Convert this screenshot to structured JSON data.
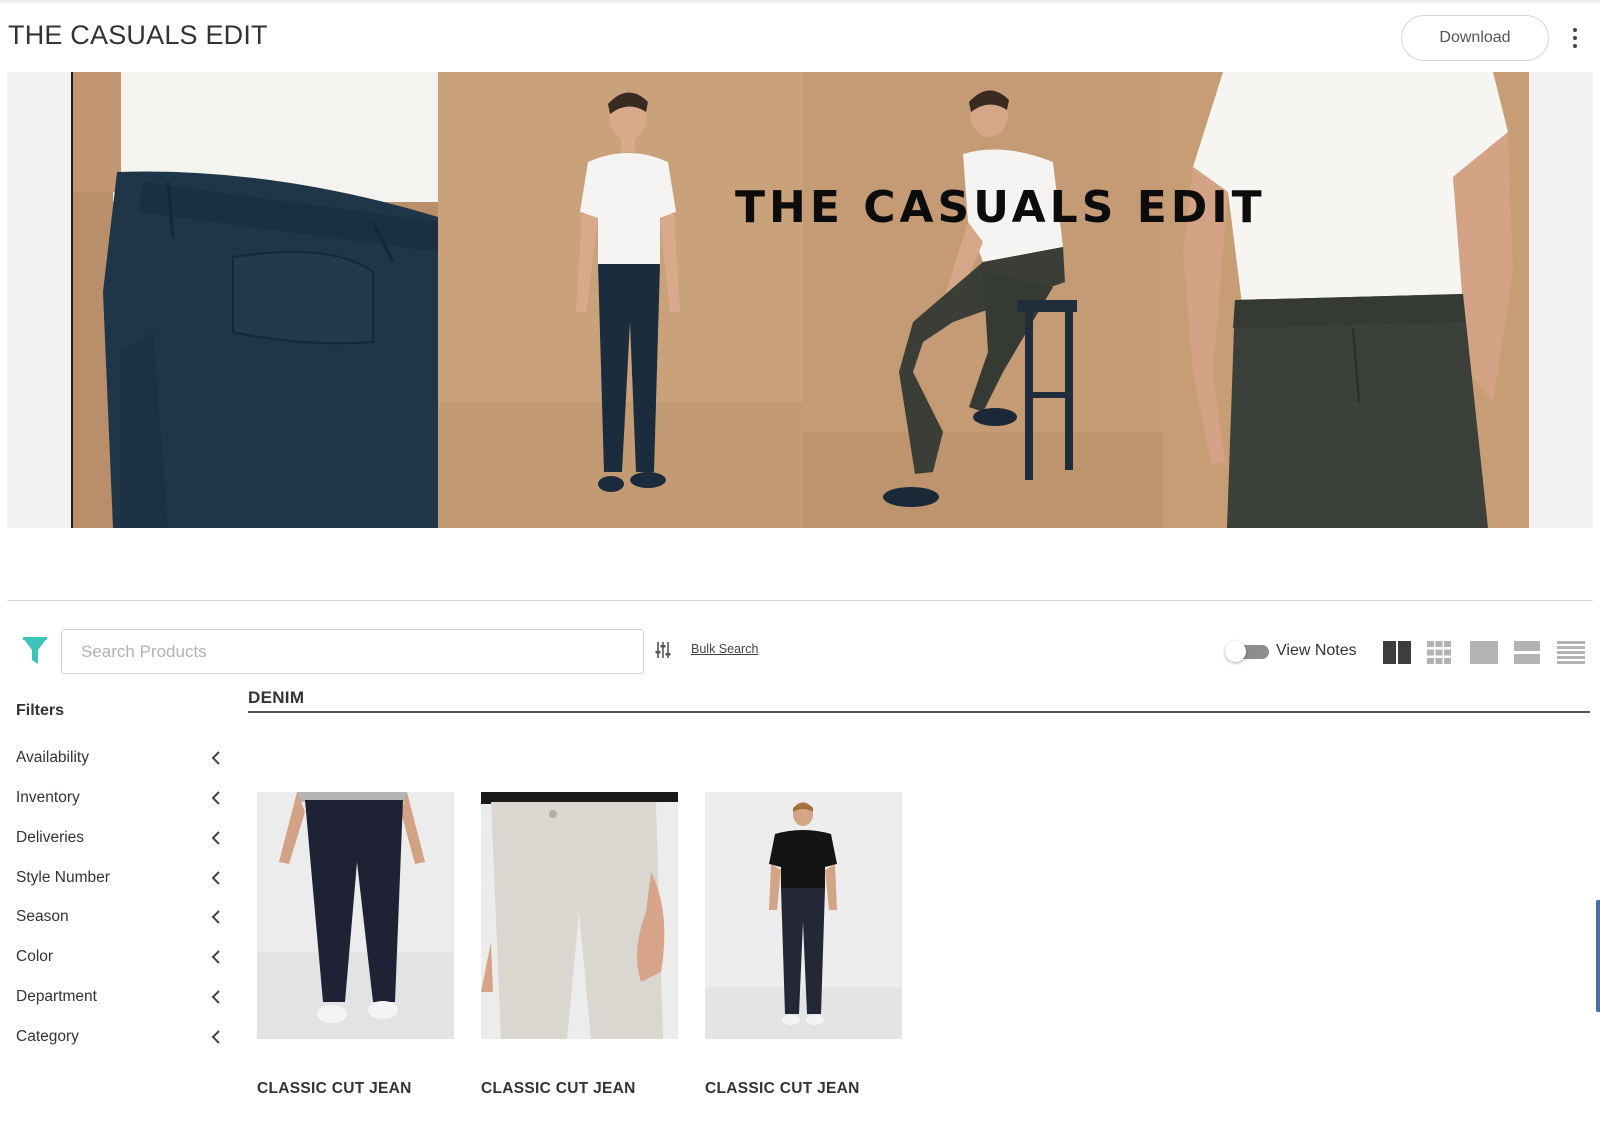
{
  "header": {
    "title": "THE CASUALS EDIT",
    "download_label": "Download",
    "more_icon": "kebab-menu-icon"
  },
  "hero": {
    "overlay_title": "THE CASUALS EDIT"
  },
  "toolbar": {
    "filter_icon": "funnel-icon",
    "search_placeholder": "Search Products",
    "search_value": "",
    "bulk_search_label": "Bulk Search",
    "view_notes_label": "View Notes",
    "view_notes_enabled": false,
    "view_modes": [
      "two-column-grid-icon",
      "small-grid-icon",
      "single-image-icon",
      "two-row-list-icon",
      "dense-list-icon"
    ]
  },
  "sidebar": {
    "heading": "Filters",
    "filters": [
      {
        "label": "Availability"
      },
      {
        "label": "Inventory"
      },
      {
        "label": "Deliveries"
      },
      {
        "label": "Style Number"
      },
      {
        "label": "Season"
      },
      {
        "label": "Color"
      },
      {
        "label": "Department"
      },
      {
        "label": "Category"
      }
    ]
  },
  "main": {
    "section_title": "DENIM",
    "products": [
      {
        "name": "CLASSIC CUT JEAN",
        "wash": "#23253a"
      },
      {
        "name": "CLASSIC CUT JEAN",
        "wash": "#d8d6ce"
      },
      {
        "name": "CLASSIC CUT JEAN",
        "wash": "#252835"
      }
    ]
  },
  "colors": {
    "accent": "#3cc5b8",
    "hero_backdrop": "#c99d74",
    "navy_pant": "#1e3446",
    "olive_pant": "#3b3f38"
  }
}
